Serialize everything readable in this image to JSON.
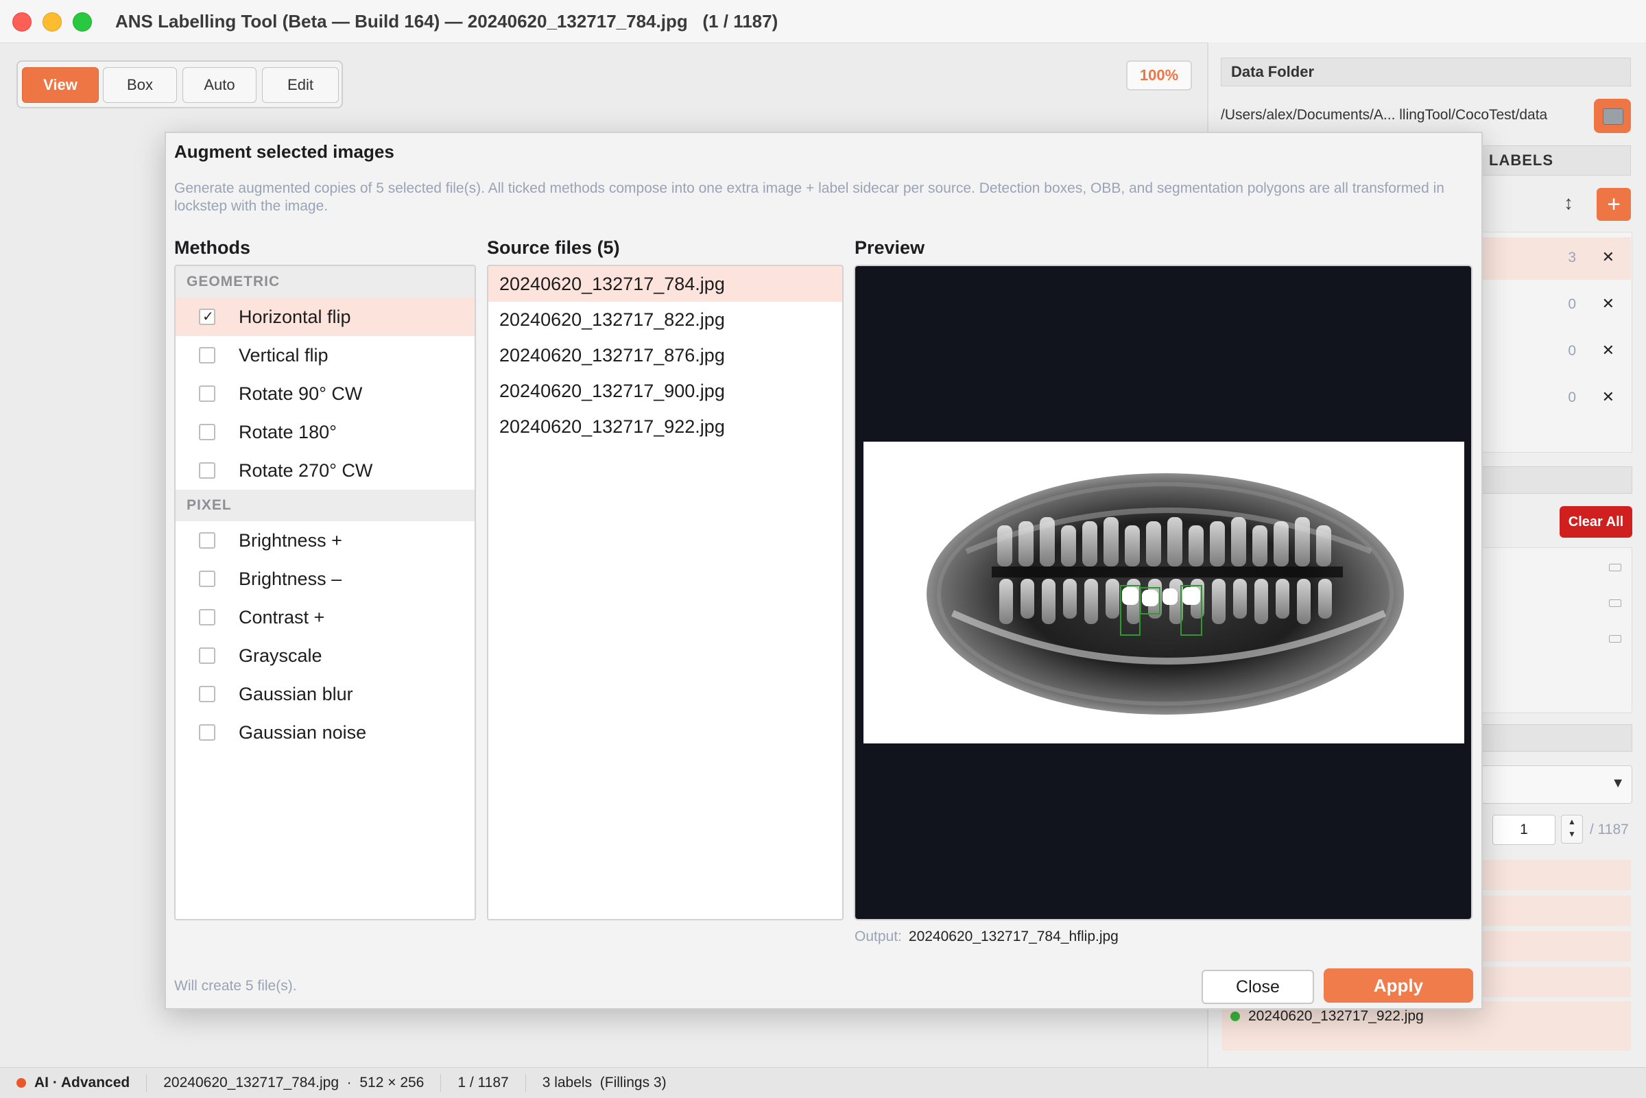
{
  "window": {
    "title": "ANS Labelling Tool (Beta — Build 164) — 20240620_132717_784.jpg   (1 / 1187)"
  },
  "toolbar": {
    "modes": [
      "View",
      "Box",
      "Auto",
      "Edit"
    ],
    "active_mode": "View",
    "zoom": "100%"
  },
  "right_panel": {
    "data_folder_header": "Data Folder",
    "data_folder_path": "/Users/alex/Documents/A... llingTool/CocoTest/data",
    "labels_header": "LABELS",
    "label_counts": [
      "3",
      "0",
      "0",
      "0"
    ],
    "clear_all": "Clear All",
    "page_value": "1",
    "page_total": "/ 1187",
    "visible_file": "20240620_132717_922.jpg"
  },
  "dialog": {
    "title": "Augment selected images",
    "description": "Generate augmented copies of 5 selected file(s). All ticked methods compose into one extra image + label sidecar per source. Detection boxes, OBB, and segmentation polygons are all transformed in lockstep with the image.",
    "methods_header": "Methods",
    "groups": [
      {
        "name": "GEOMETRIC",
        "items": [
          {
            "label": "Horizontal flip",
            "checked": true
          },
          {
            "label": "Vertical flip",
            "checked": false
          },
          {
            "label": "Rotate 90° CW",
            "checked": false
          },
          {
            "label": "Rotate 180°",
            "checked": false
          },
          {
            "label": "Rotate 270° CW",
            "checked": false
          }
        ]
      },
      {
        "name": "PIXEL",
        "items": [
          {
            "label": "Brightness +",
            "checked": false
          },
          {
            "label": "Brightness –",
            "checked": false
          },
          {
            "label": "Contrast +",
            "checked": false
          },
          {
            "label": "Grayscale",
            "checked": false
          },
          {
            "label": "Gaussian blur",
            "checked": false
          },
          {
            "label": "Gaussian noise",
            "checked": false
          }
        ]
      }
    ],
    "source_header": "Source files (5)",
    "source_files": [
      "20240620_132717_784.jpg",
      "20240620_132717_822.jpg",
      "20240620_132717_876.jpg",
      "20240620_132717_900.jpg",
      "20240620_132717_922.jpg"
    ],
    "selected_source_index": 0,
    "preview_header": "Preview",
    "output_label": "Output:",
    "output_file": "20240620_132717_784_hflip.jpg",
    "will_create": "Will create 5 file(s).",
    "close_label": "Close",
    "apply_label": "Apply"
  },
  "status_bar": {
    "mode": "AI · Advanced",
    "file": "20240620_132717_784.jpg  ·  512 × 256",
    "position": "1 / 1187",
    "labels": "3 labels  (Fillings 3)"
  },
  "colors": {
    "accent": "#ee7544",
    "danger": "#d01f1f",
    "selection": "#fce4dc",
    "status_dot": "#e8582a",
    "file_dot": "#3cb43c",
    "box": "#2f9a2f"
  }
}
